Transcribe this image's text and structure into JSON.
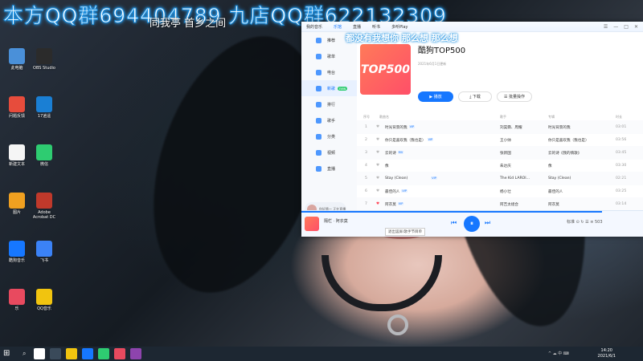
{
  "overlay": {
    "banner": "本方QQ群694404789 九店QQ群622132309",
    "sub": "同我亭 首乡之间",
    "cover_tag": "都没有我想你   那么想   那么想"
  },
  "desktop_icons": [
    {
      "label": "此电脑",
      "color": "#4a90d9"
    },
    {
      "label": "问题反馈",
      "color": "#e74c3c"
    },
    {
      "label": "新建文本",
      "color": "#f5f5f5"
    },
    {
      "label": "图片",
      "color": "#f0a020"
    },
    {
      "label": "酷狗音乐",
      "color": "#1677ff"
    },
    {
      "label": "乐",
      "color": "#e84a5f"
    },
    {
      "label": "OBS Studio",
      "color": "#2b2b2b"
    },
    {
      "label": "17逍遥",
      "color": "#1a7fd4"
    },
    {
      "label": "微信",
      "color": "#2ecc71"
    },
    {
      "label": "Adobe Acrobat DC",
      "color": "#c0392b"
    },
    {
      "label": "飞书",
      "color": "#3b82f6"
    },
    {
      "label": "QQ音乐",
      "color": "#f1c40f"
    }
  ],
  "window": {
    "tabs": [
      {
        "label": "我的音乐",
        "active": false
      },
      {
        "label": "乐馆",
        "active": true
      },
      {
        "label": "直播",
        "active": false
      },
      {
        "label": "听书",
        "active": false
      },
      {
        "label": "多听Play",
        "active": false
      }
    ],
    "controls": [
      "☰",
      "—",
      "□",
      "✕"
    ]
  },
  "sidebar": {
    "items": [
      {
        "label": "推荐",
        "active": false,
        "badge": ""
      },
      {
        "label": "歌单",
        "active": false,
        "badge": ""
      },
      {
        "label": "电台",
        "active": false,
        "badge": ""
      },
      {
        "label": "新歌",
        "active": true,
        "badge": "new"
      },
      {
        "label": "排行",
        "active": false,
        "badge": ""
      },
      {
        "label": "歌手",
        "active": false,
        "badge": ""
      },
      {
        "label": "分类",
        "active": false,
        "badge": ""
      },
      {
        "label": "视频",
        "active": false,
        "badge": ""
      },
      {
        "label": "直播",
        "active": false,
        "badge": ""
      }
    ],
    "user_label": "你好哦～ 正在直播"
  },
  "playlist": {
    "title": "酷狗TOP500",
    "cover_text": "TOP500",
    "meta": "2021年6月1日更新",
    "buttons": {
      "play": "播放",
      "download": "下载",
      "batch": "批量操作"
    }
  },
  "table": {
    "headers": {
      "index": "序号",
      "song": "歌曲名",
      "artist": "歌手",
      "album": "专辑",
      "duration": "时长"
    },
    "rows": [
      {
        "rank": "1",
        "liked": false,
        "song": "时光背景的我",
        "tag": "VIP",
        "artist": "刘昊霖、周耀",
        "album": "时光背景的我",
        "duration": "03:01"
      },
      {
        "rank": "2",
        "liked": false,
        "song": "你只是喜欢我（我也是）",
        "tag": "VIP",
        "artist": "王小帅",
        "album": "你只是喜欢我（我也是）",
        "duration": "03:56"
      },
      {
        "rank": "3",
        "liked": false,
        "song": "云的诗",
        "tag": "MV",
        "artist": "张新国",
        "album": "云的诗《我的情歌》",
        "duration": "03:45"
      },
      {
        "rank": "4",
        "liked": false,
        "song": "像",
        "tag": "",
        "artist": "朱达庆",
        "album": "像",
        "duration": "03:30"
      },
      {
        "rank": "5",
        "liked": false,
        "song": "Stay (Clean)",
        "tag": "VIP",
        "artist": "The Kid LAROI...",
        "album": "Stay (Clean)",
        "duration": "02:21"
      },
      {
        "rank": "6",
        "liked": false,
        "song": "最佳的人",
        "tag": "VIP",
        "artist": "杨小壮",
        "album": "最佳的人",
        "duration": "03:25"
      },
      {
        "rank": "7",
        "liked": true,
        "song": "阿衣莫",
        "tag": "VIP",
        "artist": "阿吉太组合",
        "album": "阿衣莫",
        "duration": "03:14"
      }
    ]
  },
  "player": {
    "now_playing": "隔栏 · 阿衣莫",
    "tooltip": "退出竖屏/歌手节目单",
    "controls": {
      "prev": "⏮",
      "play": "⏸",
      "next": "⏭"
    },
    "right": "标准  ⊙  ↻  ☰  ≡  503",
    "progress": 0.88
  },
  "taskbar": {
    "icons": [
      "#ffffff",
      "#3a4a5a",
      "#f1c40f",
      "#1677ff",
      "#2ecc71",
      "#e84a5f",
      "#8e44ad"
    ],
    "tray": "^  ☁  中  ⌨",
    "time": "14:20",
    "date": "2021/6/1"
  }
}
